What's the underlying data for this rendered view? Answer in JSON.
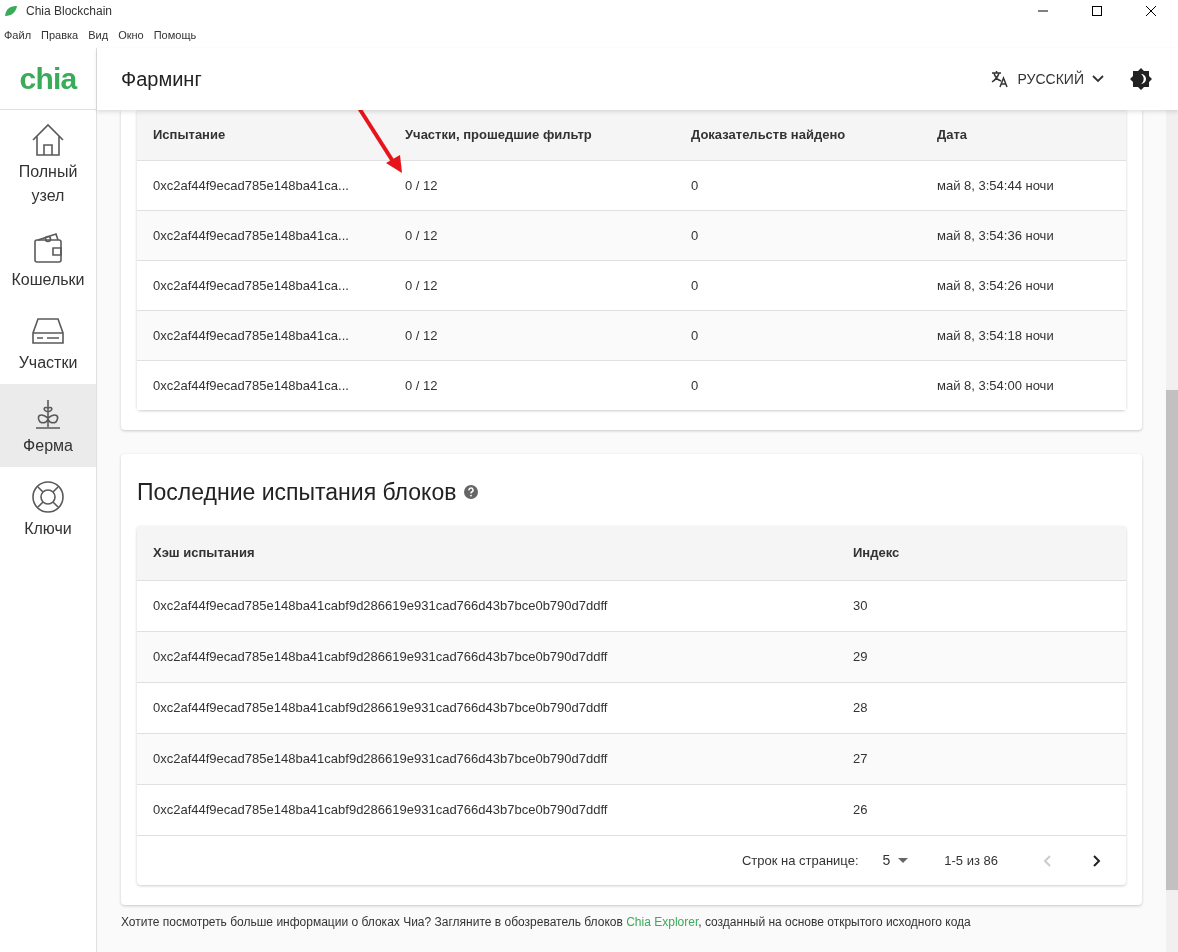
{
  "window": {
    "title": "Chia Blockchain"
  },
  "menu": [
    "Файл",
    "Правка",
    "Вид",
    "Окно",
    "Помощь"
  ],
  "logo": "chia",
  "sidebar": {
    "items": [
      {
        "label": "Полный узел",
        "selected": false
      },
      {
        "label": "Кошельки",
        "selected": false
      },
      {
        "label": "Участки",
        "selected": false
      },
      {
        "label": "Ферма",
        "selected": true
      },
      {
        "label": "Ключи",
        "selected": false
      }
    ]
  },
  "header": {
    "title": "Фарминг",
    "language": "РУССКИЙ"
  },
  "challenges": {
    "columns": [
      "Испытание",
      "Участки, прошедшие фильтр",
      "Доказательств найдено",
      "Дата"
    ],
    "rows": [
      [
        "0xc2af44f9ecad785e148ba41ca...",
        "0 / 12",
        "0",
        "май 8, 3:54:44 ночи"
      ],
      [
        "0xc2af44f9ecad785e148ba41ca...",
        "0 / 12",
        "0",
        "май 8, 3:54:36 ночи"
      ],
      [
        "0xc2af44f9ecad785e148ba41ca...",
        "0 / 12",
        "0",
        "май 8, 3:54:26 ночи"
      ],
      [
        "0xc2af44f9ecad785e148ba41ca...",
        "0 / 12",
        "0",
        "май 8, 3:54:18 ночи"
      ],
      [
        "0xc2af44f9ecad785e148ba41ca...",
        "0 / 12",
        "0",
        "май 8, 3:54:00 ночи"
      ]
    ]
  },
  "block_challenges": {
    "title": "Последние испытания блоков",
    "columns": [
      "Хэш испытания",
      "Индекс"
    ],
    "rows": [
      [
        "0xc2af44f9ecad785e148ba41cabf9d286619e931cad766d43b7bce0b790d7ddff",
        "30"
      ],
      [
        "0xc2af44f9ecad785e148ba41cabf9d286619e931cad766d43b7bce0b790d7ddff",
        "29"
      ],
      [
        "0xc2af44f9ecad785e148ba41cabf9d286619e931cad766d43b7bce0b790d7ddff",
        "28"
      ],
      [
        "0xc2af44f9ecad785e148ba41cabf9d286619e931cad766d43b7bce0b790d7ddff",
        "27"
      ],
      [
        "0xc2af44f9ecad785e148ba41cabf9d286619e931cad766d43b7bce0b790d7ddff",
        "26"
      ]
    ],
    "pagination": {
      "rows_label": "Строк на странице:",
      "rows_per_page": "5",
      "range": "1-5 из 86",
      "prev_disabled": true,
      "next_disabled": false
    }
  },
  "footer": {
    "before": "Хотите посмотреть больше информации о блоках Чиа? Загляните в обозреватель блоков ",
    "link": "Chia Explorer",
    "after": ", созданный на основе открытого исходного кода"
  }
}
